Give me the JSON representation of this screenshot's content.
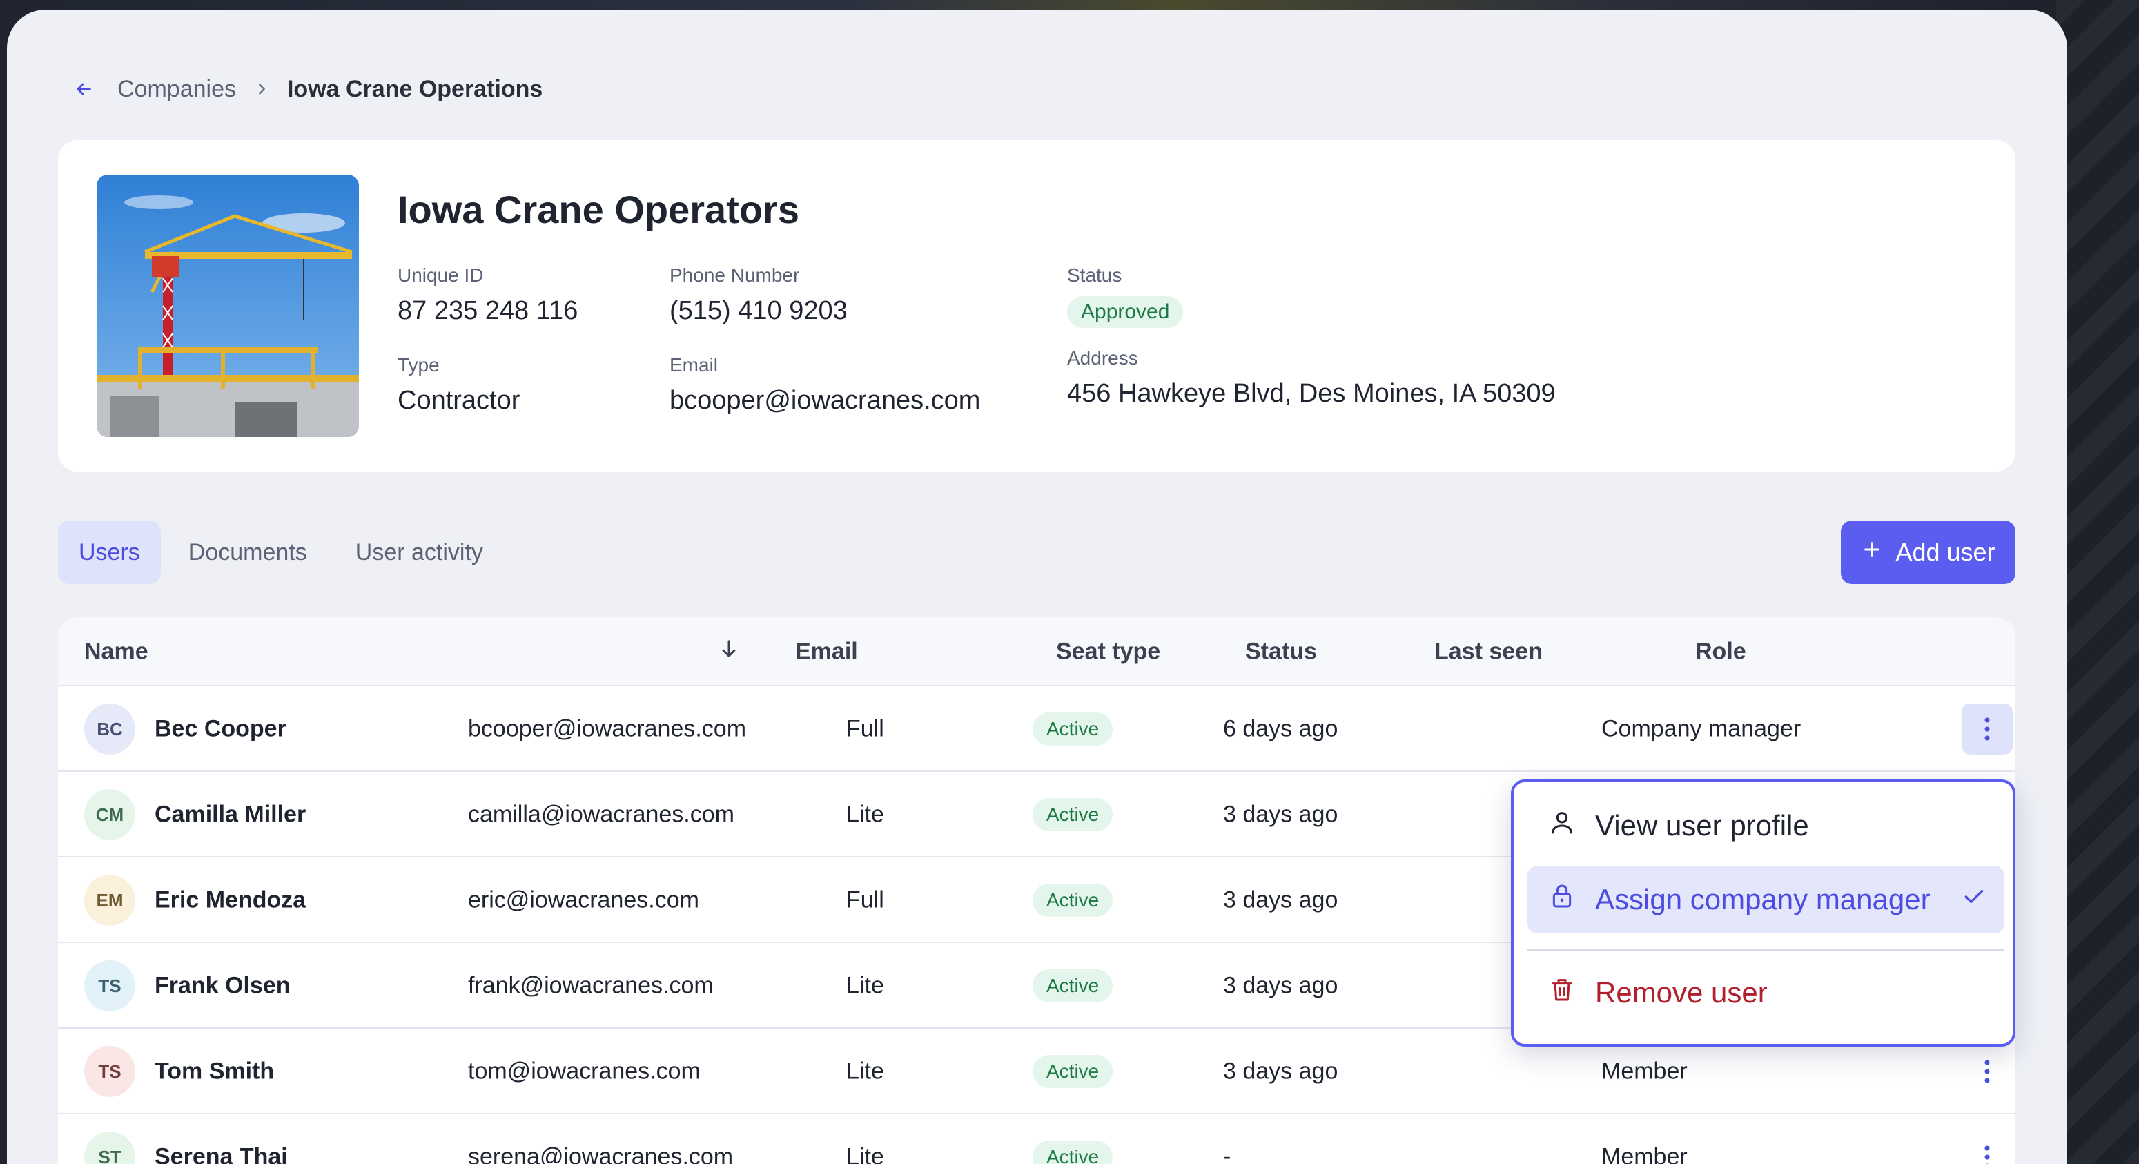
{
  "breadcrumb": {
    "parent": "Companies",
    "current": "Iowa Crane Operations"
  },
  "company": {
    "name": "Iowa Crane Operators",
    "unique_id_label": "Unique ID",
    "unique_id": "87 235 248 116",
    "phone_label": "Phone Number",
    "phone": "(515) 410 9203",
    "status_label": "Status",
    "status": "Approved",
    "type_label": "Type",
    "type": "Contractor",
    "email_label": "Email",
    "email": "bcooper@iowacranes.com",
    "address_label": "Address",
    "address": "456 Hawkeye Blvd, Des Moines, IA 50309"
  },
  "tabs": [
    {
      "label": "Users",
      "active": true
    },
    {
      "label": "Documents",
      "active": false
    },
    {
      "label": "User activity",
      "active": false
    }
  ],
  "add_user_label": "Add user",
  "table": {
    "headers": {
      "name": "Name",
      "email": "Email",
      "seat": "Seat type",
      "status": "Status",
      "last_seen": "Last seen",
      "role": "Role"
    },
    "rows": [
      {
        "initials": "BC",
        "name": "Bec Cooper",
        "email": "bcooper@iowacranes.com",
        "seat": "Full",
        "status": "Active",
        "last_seen": "6 days ago",
        "role": "Company manager",
        "avatar_bg": "#e6e9f7",
        "avatar_fg": "#4a4f73"
      },
      {
        "initials": "CM",
        "name": "Camilla Miller",
        "email": "camilla@iowacranes.com",
        "seat": "Lite",
        "status": "Active",
        "last_seen": "3 days ago",
        "role": "",
        "avatar_bg": "#e5f5ea",
        "avatar_fg": "#3f6a4c"
      },
      {
        "initials": "EM",
        "name": "Eric Mendoza",
        "email": "eric@iowacranes.com",
        "seat": "Full",
        "status": "Active",
        "last_seen": "3 days ago",
        "role": "",
        "avatar_bg": "#fbf0dc",
        "avatar_fg": "#6e5a32"
      },
      {
        "initials": "TS",
        "name": "Frank Olsen",
        "email": "frank@iowacranes.com",
        "seat": "Lite",
        "status": "Active",
        "last_seen": "3 days ago",
        "role": "",
        "avatar_bg": "#e2f2f8",
        "avatar_fg": "#3c6270"
      },
      {
        "initials": "TS",
        "name": "Tom Smith",
        "email": "tom@iowacranes.com",
        "seat": "Lite",
        "status": "Active",
        "last_seen": "3 days ago",
        "role": "Member",
        "avatar_bg": "#fbe6e6",
        "avatar_fg": "#743f3f"
      },
      {
        "initials": "ST",
        "name": "Serena Thai",
        "email": "serena@iowacranes.com",
        "seat": "Lite",
        "status": "Active",
        "last_seen": "-",
        "role": "Member",
        "avatar_bg": "#e5f5ea",
        "avatar_fg": "#3f6a4c"
      }
    ]
  },
  "menu": {
    "view_profile": "View user profile",
    "assign_manager": "Assign company manager",
    "remove_user": "Remove user"
  },
  "colors": {
    "accent": "#5b5cf0",
    "success_bg": "#e4f5ec",
    "success_fg": "#1e7a45",
    "danger": "#b3202d"
  }
}
